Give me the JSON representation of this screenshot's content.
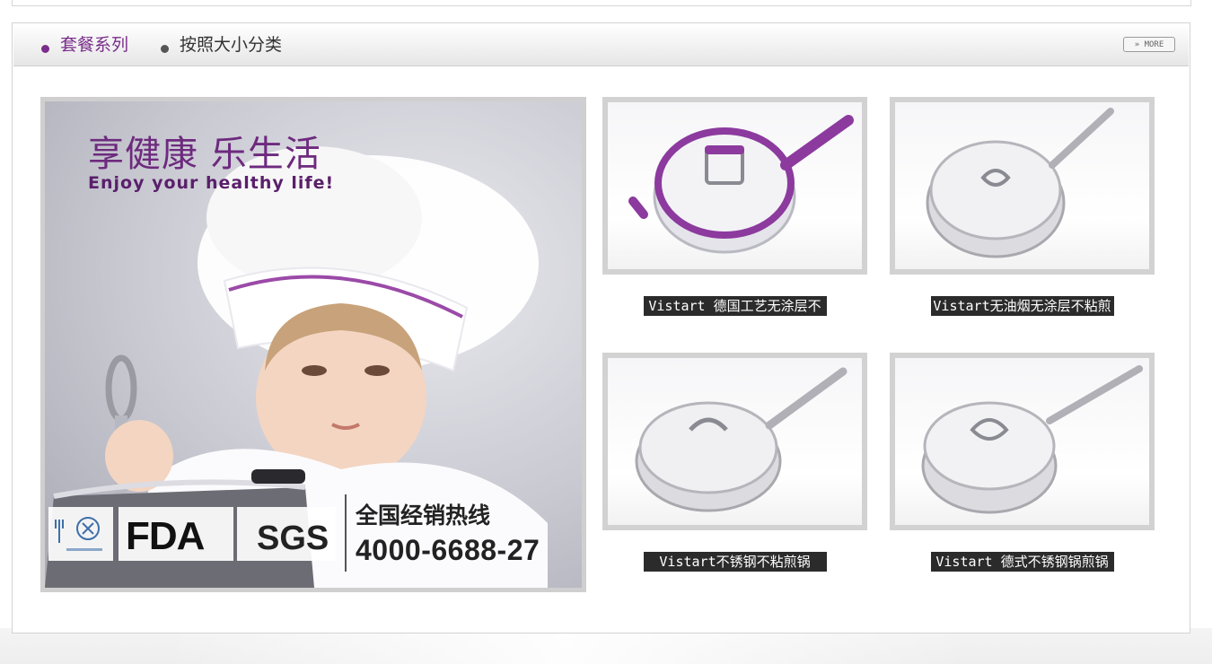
{
  "tabs": [
    {
      "label": "套餐系列",
      "active": true
    },
    {
      "label": "按照大小分类",
      "active": false
    }
  ],
  "more_label": "» MORE",
  "banner": {
    "title": "享健康 乐生活",
    "subtitle": "Enjoy your healthy life!",
    "cert_fda": "FDA",
    "cert_sgs": "SGS",
    "hotline_label": "全国经销热线",
    "hotline_number": "4000-6688-27"
  },
  "products": [
    {
      "name": "Vistart 德国工艺无涂层不",
      "image_icon": "purple-lid-saute-pan-icon"
    },
    {
      "name": "Vistart无油烟无涂层不粘煎",
      "image_icon": "steel-frying-pan-icon"
    },
    {
      "name": "Vistart不锈钢不粘煎锅",
      "image_icon": "steel-saute-pan-icon"
    },
    {
      "name": "Vistart 德式不锈钢锅煎锅",
      "image_icon": "steel-saucepan-icon"
    }
  ],
  "colors": {
    "accent": "#7a2d8a",
    "label_bg": "#2b2b2b",
    "frame": "#d2d2d2"
  }
}
